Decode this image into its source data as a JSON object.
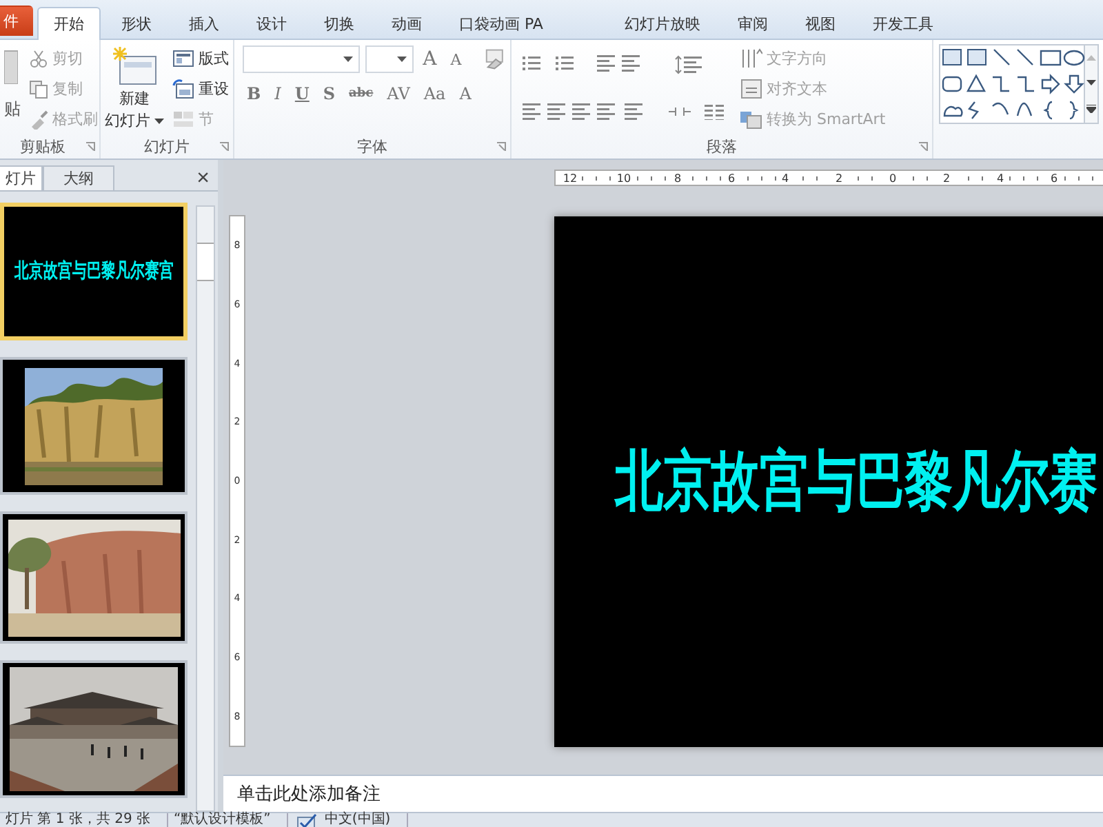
{
  "tabs": [
    {
      "label": "件",
      "kind": "file",
      "selected": false
    },
    {
      "label": "开始",
      "kind": "tab",
      "selected": true
    },
    {
      "label": "形状",
      "kind": "tab",
      "selected": false
    },
    {
      "label": "插入",
      "kind": "tab",
      "selected": false
    },
    {
      "label": "设计",
      "kind": "tab",
      "selected": false
    },
    {
      "label": "切换",
      "kind": "tab",
      "selected": false
    },
    {
      "label": "动画",
      "kind": "tab",
      "selected": false
    },
    {
      "label": "口袋动画 PA",
      "kind": "tab",
      "selected": false
    },
    {
      "label": "幻灯片放映",
      "kind": "tab",
      "selected": false
    },
    {
      "label": "审阅",
      "kind": "tab",
      "selected": false
    },
    {
      "label": "视图",
      "kind": "tab",
      "selected": false
    },
    {
      "label": "开发工具",
      "kind": "tab",
      "selected": false
    }
  ],
  "ribbon": {
    "clipboard": {
      "paste": "贴",
      "title": "剪贴板",
      "items": [
        {
          "label": "剪切",
          "disabled": true
        },
        {
          "label": "复制",
          "disabled": true
        },
        {
          "label": "格式刷",
          "disabled": true
        }
      ]
    },
    "slides": {
      "new_slide": [
        "新建",
        "幻灯片"
      ],
      "title": "幻灯片",
      "items": [
        {
          "label": "版式",
          "disabled": false
        },
        {
          "label": "重设",
          "disabled": false
        },
        {
          "label": "节",
          "disabled": true
        }
      ]
    },
    "font": {
      "title": "字体",
      "grow": "A",
      "shrink": "A",
      "buttons": [
        "B",
        "I",
        "U",
        "S",
        "abc",
        "AV",
        "Aa",
        "A"
      ]
    },
    "paragraph": {
      "title": "段落",
      "items": [
        {
          "label": "文字方向",
          "disabled": true
        },
        {
          "label": "对齐文本",
          "disabled": true
        },
        {
          "label": "转换为 SmartArt",
          "disabled": true
        }
      ]
    }
  },
  "panel": {
    "tabs": [
      {
        "label": "灯片",
        "selected": true
      },
      {
        "label": "大纲",
        "selected": false
      }
    ],
    "close": "×",
    "thumbnails": [
      {
        "kind": "title",
        "title": "北京故宫与巴黎凡尔赛宫",
        "selected": true
      },
      {
        "kind": "cliff",
        "selected": false
      },
      {
        "kind": "wall",
        "selected": false
      },
      {
        "kind": "palace",
        "selected": false
      }
    ]
  },
  "ruler": {
    "horizontal": [
      "12",
      "10",
      "8",
      "6",
      "4",
      "2",
      "0",
      "2",
      "4",
      "6"
    ],
    "vertical": [
      "8",
      "6",
      "4",
      "2",
      "0",
      "2",
      "4",
      "6",
      "8"
    ]
  },
  "slide": {
    "title": "北京故宫与巴黎凡尔赛"
  },
  "notes": {
    "prompt": "单击此处添加备注"
  },
  "status_bar": {
    "items": [
      "灯片 第 1 张，共 29 张",
      "“默认设计模板”",
      "中文(中国)"
    ]
  }
}
